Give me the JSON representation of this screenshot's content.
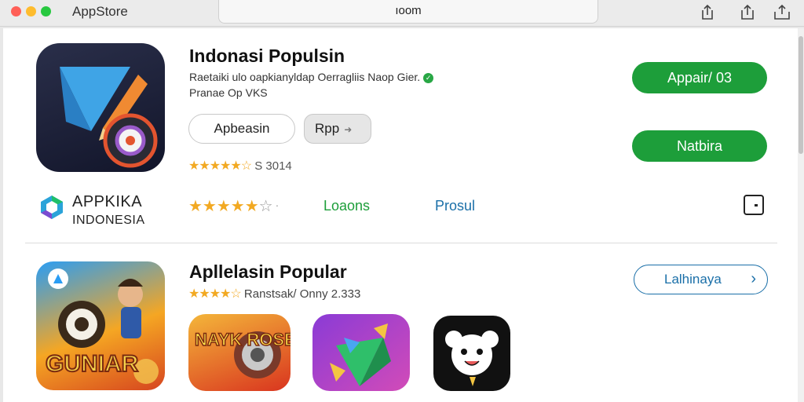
{
  "titlebar": {
    "app_name": "AppStore",
    "address": "ıoom",
    "traffic_lights": [
      "#ff5f57",
      "#febc2e",
      "#28c840"
    ]
  },
  "hero": {
    "title": "Indonasi Populsin",
    "subtitle_line1": "Raetaiki ulo oapkianyldap Oerragliis Naop Gier.",
    "subtitle_line2": "Pranae Op VKS",
    "button_outline_label": "Apbeasin",
    "button_grey_label": "Rpp",
    "rating_stars": 4.5,
    "rating_text": "S 3014",
    "primary_button_label": "Appair/ 03",
    "secondary_button_label": "Natbira",
    "accent_green": "#1d9e3a"
  },
  "brand_row": {
    "brand_line1": "APPKIKA",
    "brand_line2": "INDONESIA",
    "rating_stars": 4,
    "rating_stars_max": 5,
    "link_green": "Loaons",
    "link_blue": "Prosul",
    "link_blue_color": "#1a6fa8"
  },
  "section2": {
    "title": "Apllelasin Popular",
    "rating_stars": 4.5,
    "rating_text": "Ranstsak/ Onny 2.333",
    "more_button_label": "Lalhinaya",
    "featured_tile_text": "GUNIAR",
    "tiles": [
      {
        "icon": "game-tile-icon",
        "text": "NAYK ROSEAH"
      },
      {
        "icon": "purple-geometric-app-icon",
        "text": ""
      },
      {
        "icon": "panda-app-icon",
        "text": ""
      }
    ]
  }
}
